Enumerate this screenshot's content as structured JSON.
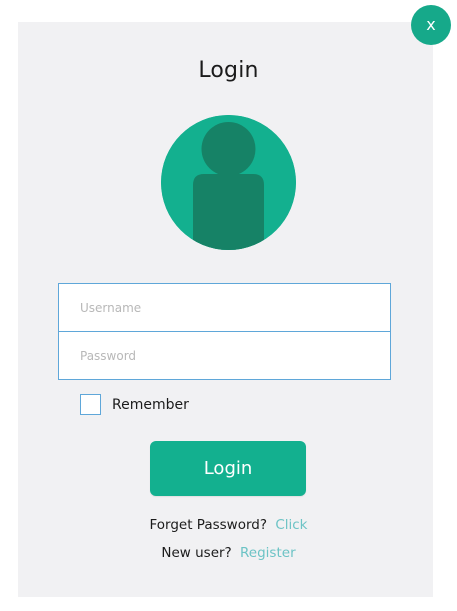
{
  "close_button": {
    "label": "x"
  },
  "title": "Login",
  "form": {
    "username": {
      "placeholder": "Username",
      "value": ""
    },
    "password": {
      "placeholder": "Password",
      "value": ""
    }
  },
  "remember": {
    "label": "Remember",
    "checked": false
  },
  "login_button": {
    "label": "Login"
  },
  "forgot": {
    "text": "Forget Password?",
    "link": "Click"
  },
  "register": {
    "text": "New user?",
    "link": "Register"
  },
  "colors": {
    "accent": "#13b08f",
    "accent_dark": "#168266",
    "link": "#6cc3c5",
    "border": "#5fa7d9",
    "card_background": "#f1f1f3"
  },
  "icons": {
    "avatar": "user-avatar-icon"
  }
}
